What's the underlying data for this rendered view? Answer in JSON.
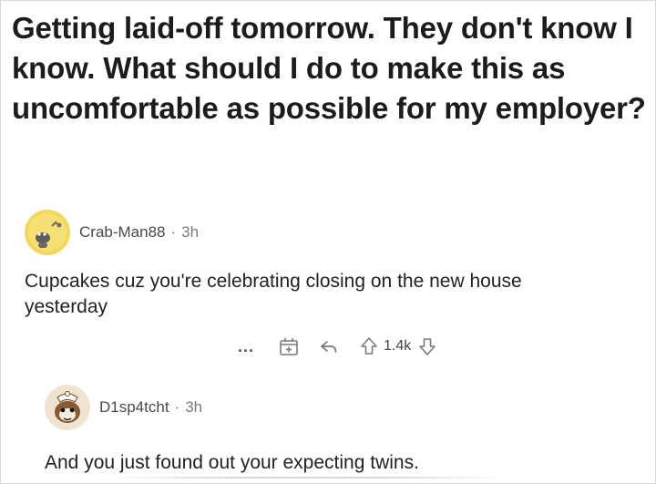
{
  "post": {
    "title": "Getting laid-off tomorrow. They don't know I know. What should I do to make this as uncomfortable as possible for my employer?"
  },
  "comments": [
    {
      "username": "Crab-Man88",
      "separator": "·",
      "time": "3h",
      "body": "Cupcakes cuz you're celebrating closing on the new house yesterday",
      "actions": {
        "more_label": "...",
        "award_icon": "award-icon",
        "reply_icon": "reply-icon",
        "upvote_icon": "upvote-arrow-icon",
        "vote_count": "1.4k",
        "downvote_icon": "downvote-arrow-icon"
      },
      "avatar_color": "#f0cf4b"
    },
    {
      "username": "D1sp4tcht",
      "separator": "·",
      "time": "3h",
      "body": "And you just found out your expecting twins.",
      "avatar_color": "#f1e4cf"
    }
  ]
}
